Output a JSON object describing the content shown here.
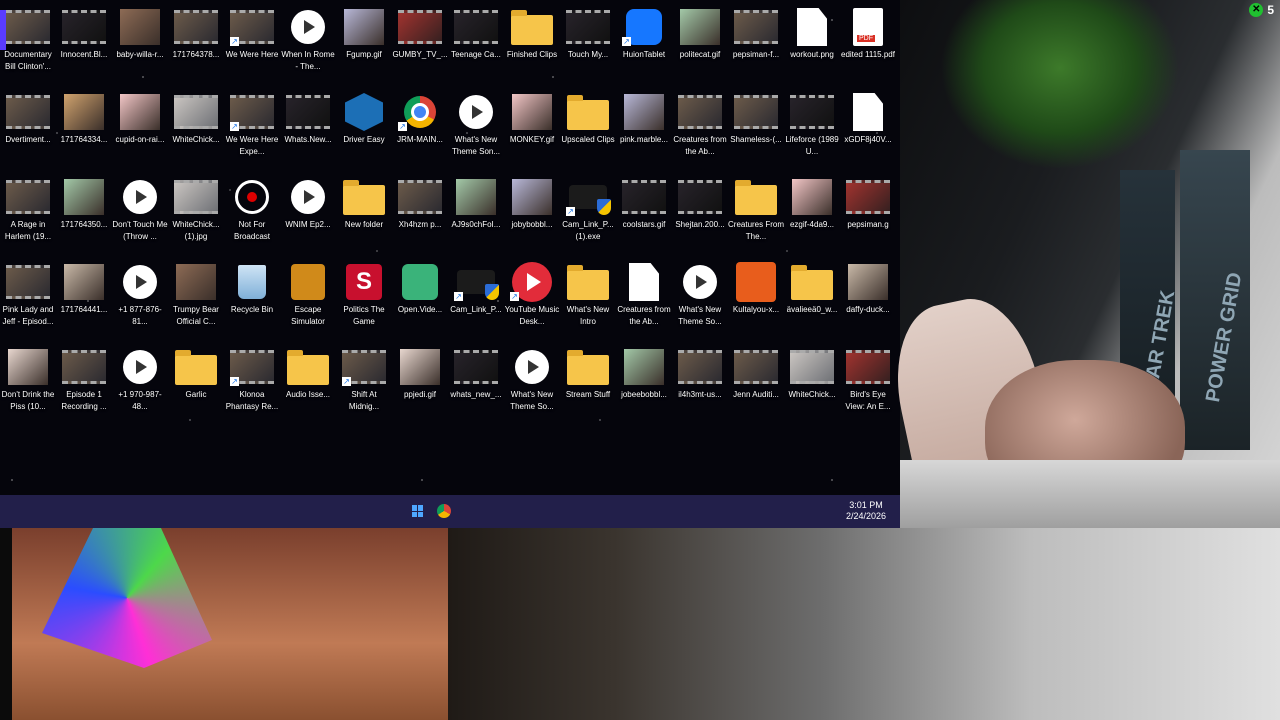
{
  "badge": {
    "count": "5"
  },
  "taskbar": {
    "time": "3:01 PM",
    "date": "2/24/2026"
  },
  "camera_text": {
    "book1": "STAR TREK",
    "book2": "POWER GRID"
  },
  "icons": [
    {
      "label": "Documentary Bill Clinton'...",
      "kind": "video-thumbnail"
    },
    {
      "label": "Innocent.Bl...",
      "kind": "video-thumbnail-dark"
    },
    {
      "label": "baby-willa-r...",
      "kind": "image"
    },
    {
      "label": "171764378...",
      "kind": "video-thumbnail"
    },
    {
      "label": "We Were Here",
      "kind": "app-shortcut"
    },
    {
      "label": "When In Rome - The...",
      "kind": "media-play"
    },
    {
      "label": "Fgump.gif",
      "kind": "image"
    },
    {
      "label": "GUMBY_TV_...",
      "kind": "video-thumbnail-red"
    },
    {
      "label": "Teenage Ca...",
      "kind": "video-thumbnail-dark"
    },
    {
      "label": "Finished Clips",
      "kind": "folder"
    },
    {
      "label": "Touch My...",
      "kind": "video-thumbnail-dark"
    },
    {
      "label": "HuionTablet",
      "kind": "app-shortcut-pencil"
    },
    {
      "label": "politecat.gif",
      "kind": "image"
    },
    {
      "label": "pepsiman-f...",
      "kind": "video-thumbnail"
    },
    {
      "label": "workout.png",
      "kind": "document"
    },
    {
      "label": "edited 1115.pdf",
      "kind": "pdf"
    },
    {
      "label": "Dvertiment...",
      "kind": "video-thumbnail"
    },
    {
      "label": "171764334...",
      "kind": "image"
    },
    {
      "label": "cupid-on-rai...",
      "kind": "image"
    },
    {
      "label": "WhiteChick...",
      "kind": "video-thumbnail-light"
    },
    {
      "label": "We Were Here Expe...",
      "kind": "app-shortcut"
    },
    {
      "label": "Whats.New...",
      "kind": "video-thumbnail-dark"
    },
    {
      "label": "Driver Easy",
      "kind": "app-gear"
    },
    {
      "label": "JRM-MAIN...",
      "kind": "chrome"
    },
    {
      "label": "What's New Theme Son...",
      "kind": "media-play"
    },
    {
      "label": "MONKEY.gif",
      "kind": "image"
    },
    {
      "label": "Upscaled Clips",
      "kind": "folder"
    },
    {
      "label": "pink.marble...",
      "kind": "image"
    },
    {
      "label": "Creatures from the Ab...",
      "kind": "video-thumbnail"
    },
    {
      "label": "Shameless-(...",
      "kind": "video-thumbnail"
    },
    {
      "label": "Lifeforce (1989 U...",
      "kind": "video-thumbnail-dark"
    },
    {
      "label": "xGDF8j40V...",
      "kind": "document"
    },
    {
      "label": "A Rage in Harlem (19...",
      "kind": "video-thumbnail"
    },
    {
      "label": "171764350...",
      "kind": "image"
    },
    {
      "label": "Don't Touch Me (Throw ...",
      "kind": "media-play"
    },
    {
      "label": "WhiteChick... (1).jpg",
      "kind": "video-thumbnail-light"
    },
    {
      "label": "Not For Broadcast",
      "kind": "app-eye"
    },
    {
      "label": "WNIM Ep2...",
      "kind": "media-play"
    },
    {
      "label": "New folder",
      "kind": "folder"
    },
    {
      "label": "Xh4hzm p...",
      "kind": "video-thumbnail"
    },
    {
      "label": "AJ9s0chFoI...",
      "kind": "image"
    },
    {
      "label": "jobybobbl...",
      "kind": "image"
    },
    {
      "label": "Cam_Link_P... (1).exe",
      "kind": "exe"
    },
    {
      "label": "coolstars.gif",
      "kind": "video-thumbnail-dark"
    },
    {
      "label": "Shejtan.200...",
      "kind": "video-thumbnail-dark"
    },
    {
      "label": "Creatures From The...",
      "kind": "folder"
    },
    {
      "label": "ezgif-4da9...",
      "kind": "image"
    },
    {
      "label": "pepsiman.g",
      "kind": "video-thumbnail-red"
    },
    {
      "label": "Pink Lady and Jeff - Episod...",
      "kind": "video-thumbnail"
    },
    {
      "label": "171764441...",
      "kind": "image"
    },
    {
      "label": "+1 877-876-81...",
      "kind": "media-play"
    },
    {
      "label": "Trumpy Bear Official C...",
      "kind": "image"
    },
    {
      "label": "Recycle Bin",
      "kind": "recycle-bin"
    },
    {
      "label": "Escape Simulator",
      "kind": "app-keyhole"
    },
    {
      "label": "Politics The Game",
      "kind": "app-s"
    },
    {
      "label": "Open.Vide...",
      "kind": "app-green"
    },
    {
      "label": "Cam_Link_P...",
      "kind": "exe"
    },
    {
      "label": "YouTube Music Desk...",
      "kind": "youtube"
    },
    {
      "label": "What's New Intro",
      "kind": "folder"
    },
    {
      "label": "Creatures from the Ab...",
      "kind": "document"
    },
    {
      "label": "What's New Theme So...",
      "kind": "media-play"
    },
    {
      "label": "Kultalyou-x...",
      "kind": "app-orange"
    },
    {
      "label": "ävalieeä0_w...",
      "kind": "folder"
    },
    {
      "label": "daffy-duck...",
      "kind": "image"
    },
    {
      "label": "Don't Drink the Piss (10...",
      "kind": "image"
    },
    {
      "label": "Episode 1 Recording ...",
      "kind": "video-thumbnail"
    },
    {
      "label": "+1 970-987-48...",
      "kind": "media-play"
    },
    {
      "label": "Garlic",
      "kind": "folder"
    },
    {
      "label": "Klonoa Phantasy Re...",
      "kind": "app-shortcut"
    },
    {
      "label": "Audio Isse...",
      "kind": "folder"
    },
    {
      "label": "Shift At Midnig...",
      "kind": "app-shortcut"
    },
    {
      "label": "ppjedi.gif",
      "kind": "image"
    },
    {
      "label": "whats_new_...",
      "kind": "video-thumbnail-dark"
    },
    {
      "label": "What's New Theme So...",
      "kind": "media-play"
    },
    {
      "label": "Stream Stuff",
      "kind": "folder"
    },
    {
      "label": "jobeebobbl...",
      "kind": "image"
    },
    {
      "label": "il4h3mt-us...",
      "kind": "video-thumbnail"
    },
    {
      "label": "Jenn Auditi...",
      "kind": "video-thumbnail"
    },
    {
      "label": "WhiteChick...",
      "kind": "video-thumbnail-light"
    },
    {
      "label": "Bird's Eye View: An E...",
      "kind": "video-thumbnail-red"
    }
  ]
}
